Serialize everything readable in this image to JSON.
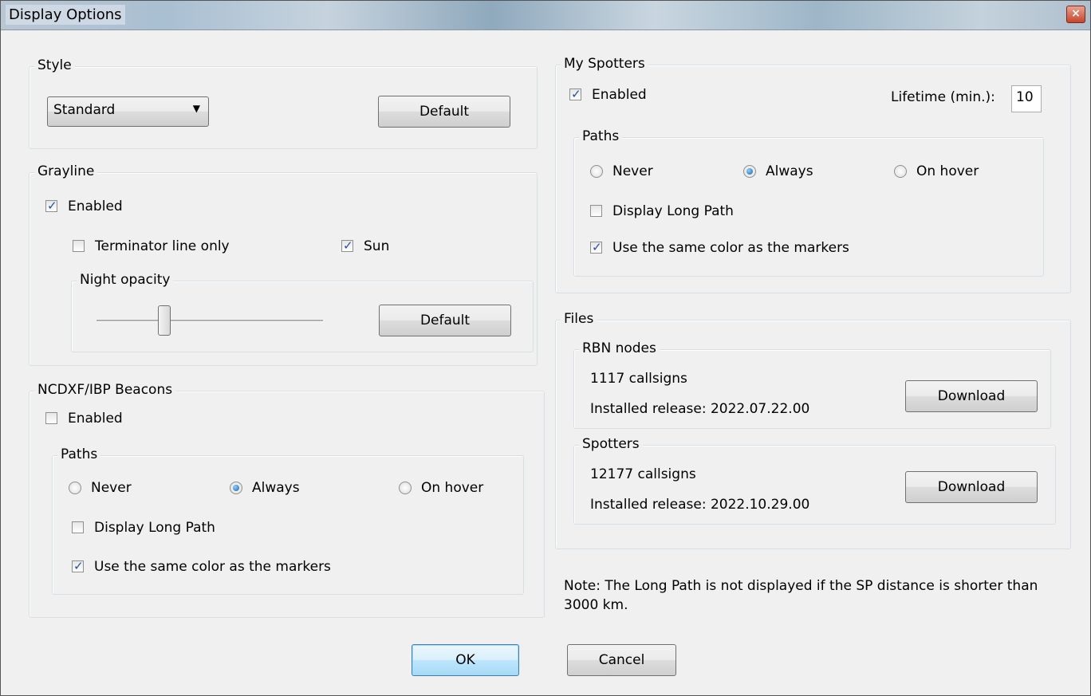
{
  "window": {
    "title": "Display Options",
    "close_glyph": "×"
  },
  "style": {
    "legend": "Style",
    "select_value": "Standard",
    "default_label": "Default"
  },
  "grayline": {
    "legend": "Grayline",
    "enabled_label": "Enabled",
    "enabled": true,
    "terminator_label": "Terminator line only",
    "terminator": false,
    "sun_label": "Sun",
    "sun": true,
    "night_opacity": {
      "legend": "Night opacity",
      "default_label": "Default",
      "slider_level": 0.3
    }
  },
  "beacons": {
    "legend": "NCDXF/IBP Beacons",
    "enabled_label": "Enabled",
    "enabled": false,
    "paths": {
      "legend": "Paths",
      "never_label": "Never",
      "always_label": "Always",
      "on_hover_label": "On hover",
      "selected": "Always",
      "long_path_label": "Display Long Path",
      "long_path": false,
      "same_color_label": "Use the same color as the markers",
      "same_color": true
    }
  },
  "spotters": {
    "legend": "My Spotters",
    "enabled_label": "Enabled",
    "enabled": true,
    "lifetime_label": "Lifetime (min.):",
    "lifetime_value": "10",
    "paths": {
      "legend": "Paths",
      "never_label": "Never",
      "always_label": "Always",
      "on_hover_label": "On hover",
      "selected": "Always",
      "long_path_label": "Display Long Path",
      "long_path": false,
      "same_color_label": "Use the same color as the markers",
      "same_color": true
    }
  },
  "files": {
    "legend": "Files",
    "rbn": {
      "legend": "RBN nodes",
      "count": "1117 callsigns",
      "release": "Installed release: 2022.07.22.00",
      "download_label": "Download"
    },
    "spotters": {
      "legend": "Spotters",
      "count": "12177 callsigns",
      "release": "Installed release: 2022.10.29.00",
      "download_label": "Download"
    }
  },
  "note": "Note: The Long Path is not displayed if the SP distance is shorter than 3000 km.",
  "ok_label": "OK",
  "cancel_label": "Cancel",
  "check_glyph": "✓"
}
